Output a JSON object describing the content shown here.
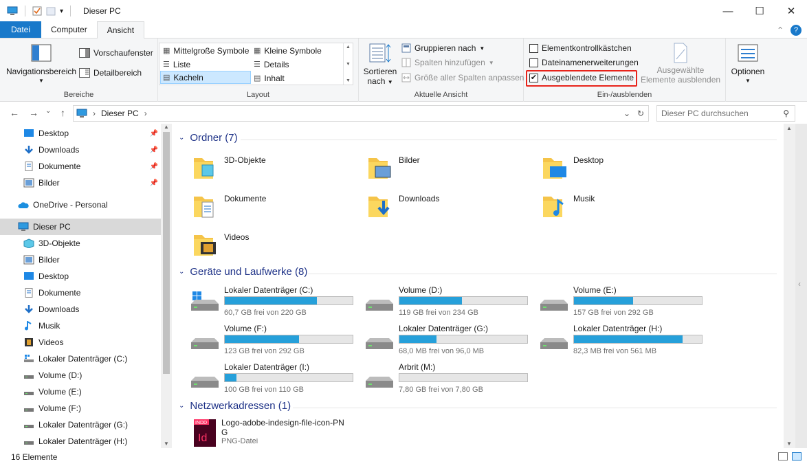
{
  "window": {
    "title": "Dieser PC",
    "qat_dropdown": "▾",
    "minimize": "—",
    "maximize": "☐",
    "close": "✕"
  },
  "ribbon_tabs": [
    "Datei",
    "Computer",
    "Ansicht"
  ],
  "ribbon_collapse": "⌃",
  "help": "?",
  "groups": {
    "bereiche": {
      "label": "Bereiche",
      "nav_button": "Navigationsbereich",
      "preview": "Vorschaufenster",
      "details": "Detailbereich"
    },
    "layout": {
      "label": "Layout",
      "items": [
        "Mittelgroße Symbole",
        "Kleine Symbole",
        "Liste",
        "Details",
        "Kacheln",
        "Inhalt"
      ],
      "selected": "Kacheln"
    },
    "aktuelle_ansicht": {
      "label": "Aktuelle Ansicht",
      "sort_line1": "Sortieren",
      "sort_line2": "nach",
      "group_by": "Gruppieren nach",
      "add_columns": "Spalten hinzufügen",
      "fit_columns": "Größe aller Spalten anpassen"
    },
    "ein_ausblenden": {
      "label": "Ein-/ausblenden",
      "checkboxes": [
        {
          "label": "Elementkontrollkästchen",
          "checked": false
        },
        {
          "label": "Dateinamenerweiterungen",
          "checked": false
        },
        {
          "label": "Ausgeblendete Elemente",
          "checked": true
        }
      ],
      "hide_selected_line1": "Ausgewählte",
      "hide_selected_line2": "Elemente ausblenden"
    },
    "optionen": {
      "label": "Optionen"
    }
  },
  "address": {
    "back": "←",
    "forward": "→",
    "recent": "⌄",
    "up": "↑",
    "path": "Dieser PC",
    "chevron": "›",
    "dropdown": "⌄",
    "refresh": "↻",
    "search_placeholder": "Dieser PC durchsuchen"
  },
  "nav_pane": {
    "quick_access": [
      "Desktop",
      "Downloads",
      "Dokumente",
      "Bilder"
    ],
    "onedrive": "OneDrive - Personal",
    "this_pc": "Dieser PC",
    "this_pc_children": [
      "3D-Objekte",
      "Bilder",
      "Desktop",
      "Dokumente",
      "Downloads",
      "Musik",
      "Videos",
      "Lokaler Datenträger (C:)",
      "Volume (D:)",
      "Volume (E:)",
      "Volume (F:)",
      "Lokaler Datenträger (G:)",
      "Lokaler Datenträger (H:)"
    ]
  },
  "content": {
    "folders_header": "Ordner (7)",
    "folders": [
      "3D-Objekte",
      "Bilder",
      "Desktop",
      "Dokumente",
      "Downloads",
      "Musik",
      "Videos"
    ],
    "drives_header": "Geräte und Laufwerke (8)",
    "drives": [
      {
        "name": "Lokaler Datenträger (C:)",
        "free": "60,7 GB frei von 220 GB",
        "used_fraction": 0.72,
        "os": true
      },
      {
        "name": "Volume (D:)",
        "free": "119 GB frei von 234 GB",
        "used_fraction": 0.49
      },
      {
        "name": "Volume (E:)",
        "free": "157 GB frei von 292 GB",
        "used_fraction": 0.46
      },
      {
        "name": "Volume (F:)",
        "free": "123 GB frei von 292 GB",
        "used_fraction": 0.58
      },
      {
        "name": "Lokaler Datenträger (G:)",
        "free": "68,0 MB frei von 96,0 MB",
        "used_fraction": 0.29
      },
      {
        "name": "Lokaler Datenträger (H:)",
        "free": "82,3 MB frei von 561 MB",
        "used_fraction": 0.85
      },
      {
        "name": "Lokaler Datenträger (I:)",
        "free": "100 GB frei von 110 GB",
        "used_fraction": 0.09
      },
      {
        "name": "Arbrit (M:)",
        "free": "7,80 GB frei von 7,80 GB",
        "used_fraction": 0.0
      }
    ],
    "network_header": "Netzwerkadressen (1)",
    "network_item_line1": "Logo-adobe-indesign-file-icon-PN",
    "network_item_line2": "G",
    "network_item_type": "PNG-Datei",
    "indd_badge": "INDD",
    "id_letters": "Id"
  },
  "status": {
    "count": "16 Elemente"
  },
  "colors": {
    "accent": "#1979ca",
    "bar_fill": "#26a0da",
    "highlight": "#e8231a",
    "section_header": "#1e3287"
  }
}
